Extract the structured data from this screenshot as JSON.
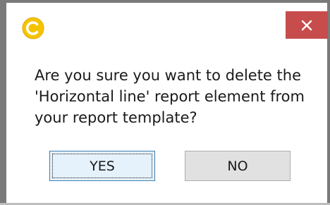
{
  "dialog": {
    "app_icon": "copernic-c-icon",
    "close_icon": "close-x-icon",
    "message": "Are you sure you want to delete the\n'Horizontal line' report element from\nyour report template?",
    "yes_label": "YES",
    "no_label": "NO"
  },
  "colors": {
    "close_button_bg": "#c74c4c",
    "app_icon_fill": "#f5c400",
    "window_border": "#7a7a7a"
  }
}
